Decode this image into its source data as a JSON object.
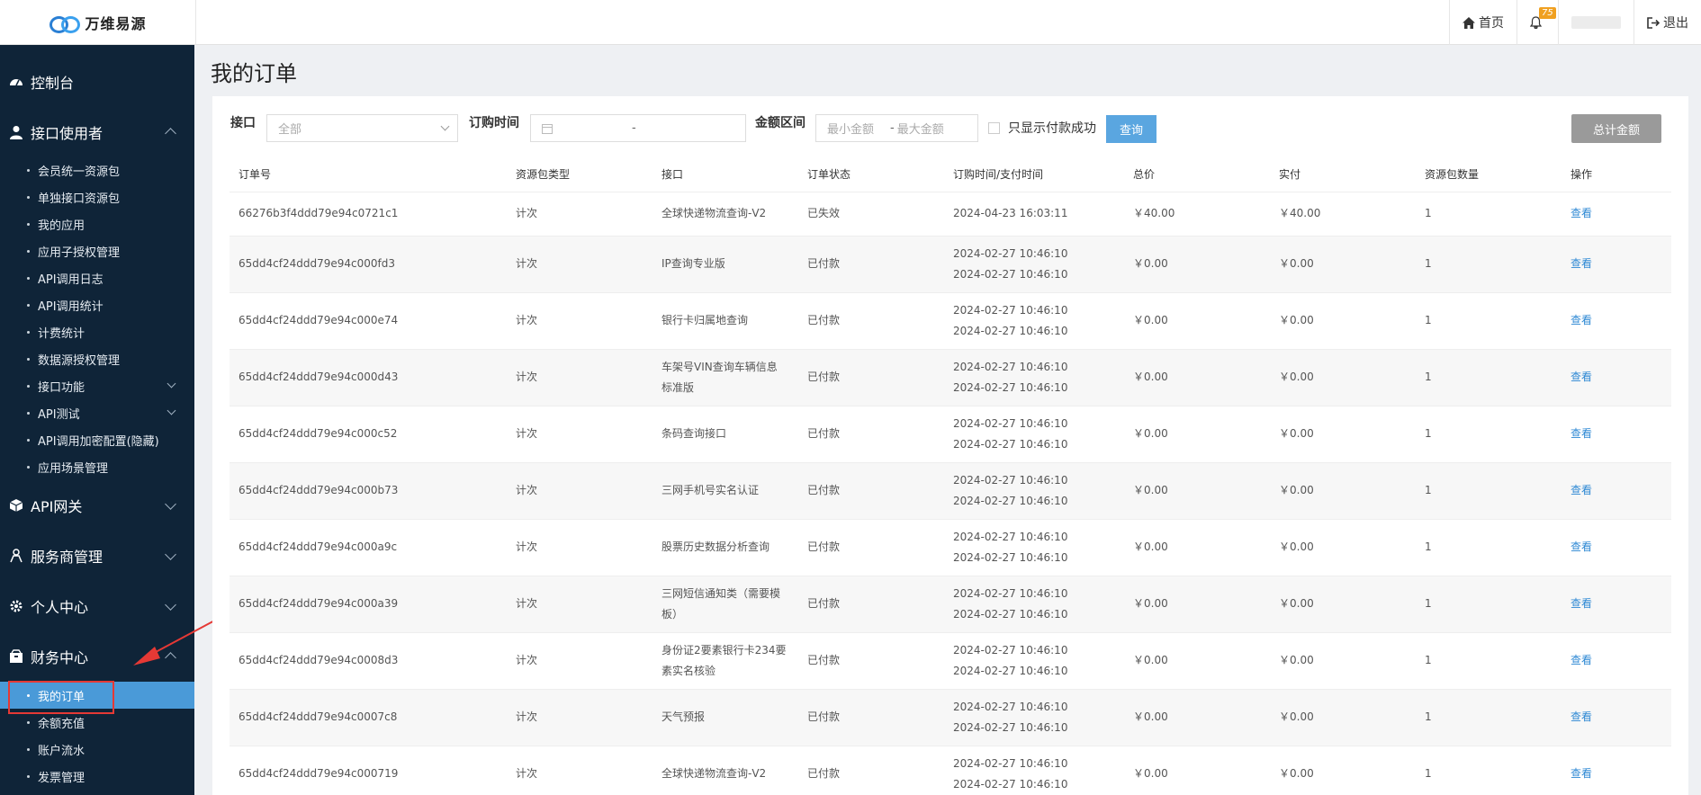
{
  "app": {
    "logo_text": "万维易源"
  },
  "topbar": {
    "home": "首页",
    "notif_count": "75",
    "logout": "退出"
  },
  "sidebar": {
    "console": "控制台",
    "api_user": "接口使用者",
    "api_user_items": [
      "会员统一资源包",
      "单独接口资源包",
      "我的应用",
      "应用子授权管理",
      "API调用日志",
      "API调用统计",
      "计费统计",
      "数据源授权管理",
      "接口功能",
      "API测试",
      "API调用加密配置(隐藏)",
      "应用场景管理"
    ],
    "gateway": "API网关",
    "provider": "服务商管理",
    "personal": "个人中心",
    "finance": "财务中心",
    "finance_items": [
      "我的订单",
      "余额充值",
      "账户流水",
      "发票管理"
    ]
  },
  "page": {
    "title": "我的订单"
  },
  "filters": {
    "api_label": "接口",
    "api_value": "全部",
    "time_label": "订购时间",
    "date_sep": "-",
    "amount_label": "金额区间",
    "min_placeholder": "最小金额",
    "amount_sep": "-",
    "max_placeholder": "最大金额",
    "paid_only": "只显示付款成功",
    "query_btn": "查询",
    "total_btn": "总计金额"
  },
  "table": {
    "headers": [
      "订单号",
      "资源包类型",
      "接口",
      "订单状态",
      "订购时间/支付时间",
      "总价",
      "实付",
      "资源包数量",
      "操作"
    ],
    "rows": [
      {
        "id": "66276b3f4ddd79e94c0721c1",
        "type": "计次",
        "api": "全球快递物流查询-V2",
        "status": "已失效",
        "time1": "2024-04-23 16:03:11",
        "time2": "",
        "total": "￥40.00",
        "paid": "￥40.00",
        "qty": "1",
        "op": "查看"
      },
      {
        "id": "65dd4cf24ddd79e94c000fd3",
        "type": "计次",
        "api": "IP查询专业版",
        "status": "已付款",
        "time1": "2024-02-27 10:46:10",
        "time2": "2024-02-27 10:46:10",
        "total": "￥0.00",
        "paid": "￥0.00",
        "qty": "1",
        "op": "查看"
      },
      {
        "id": "65dd4cf24ddd79e94c000e74",
        "type": "计次",
        "api": "银行卡归属地查询",
        "status": "已付款",
        "time1": "2024-02-27 10:46:10",
        "time2": "2024-02-27 10:46:10",
        "total": "￥0.00",
        "paid": "￥0.00",
        "qty": "1",
        "op": "查看"
      },
      {
        "id": "65dd4cf24ddd79e94c000d43",
        "type": "计次",
        "api": "车架号VIN查询车辆信息标准版",
        "status": "已付款",
        "time1": "2024-02-27 10:46:10",
        "time2": "2024-02-27 10:46:10",
        "total": "￥0.00",
        "paid": "￥0.00",
        "qty": "1",
        "op": "查看"
      },
      {
        "id": "65dd4cf24ddd79e94c000c52",
        "type": "计次",
        "api": "条码查询接口",
        "status": "已付款",
        "time1": "2024-02-27 10:46:10",
        "time2": "2024-02-27 10:46:10",
        "total": "￥0.00",
        "paid": "￥0.00",
        "qty": "1",
        "op": "查看"
      },
      {
        "id": "65dd4cf24ddd79e94c000b73",
        "type": "计次",
        "api": "三网手机号实名认证",
        "status": "已付款",
        "time1": "2024-02-27 10:46:10",
        "time2": "2024-02-27 10:46:10",
        "total": "￥0.00",
        "paid": "￥0.00",
        "qty": "1",
        "op": "查看"
      },
      {
        "id": "65dd4cf24ddd79e94c000a9c",
        "type": "计次",
        "api": "股票历史数据分析查询",
        "status": "已付款",
        "time1": "2024-02-27 10:46:10",
        "time2": "2024-02-27 10:46:10",
        "total": "￥0.00",
        "paid": "￥0.00",
        "qty": "1",
        "op": "查看"
      },
      {
        "id": "65dd4cf24ddd79e94c000a39",
        "type": "计次",
        "api": "三网短信通知类（需要模板）",
        "status": "已付款",
        "time1": "2024-02-27 10:46:10",
        "time2": "2024-02-27 10:46:10",
        "total": "￥0.00",
        "paid": "￥0.00",
        "qty": "1",
        "op": "查看"
      },
      {
        "id": "65dd4cf24ddd79e94c0008d3",
        "type": "计次",
        "api": "身份证2要素银行卡234要素实名核验",
        "status": "已付款",
        "time1": "2024-02-27 10:46:10",
        "time2": "2024-02-27 10:46:10",
        "total": "￥0.00",
        "paid": "￥0.00",
        "qty": "1",
        "op": "查看"
      },
      {
        "id": "65dd4cf24ddd79e94c0007c8",
        "type": "计次",
        "api": "天气预报",
        "status": "已付款",
        "time1": "2024-02-27 10:46:10",
        "time2": "2024-02-27 10:46:10",
        "total": "￥0.00",
        "paid": "￥0.00",
        "qty": "1",
        "op": "查看"
      },
      {
        "id": "65dd4cf24ddd79e94c000719",
        "type": "计次",
        "api": "全球快递物流查询-V2",
        "status": "已付款",
        "time1": "2024-02-27 10:46:10",
        "time2": "2024-02-27 10:46:10",
        "total": "￥0.00",
        "paid": "￥0.00",
        "qty": "1",
        "op": "查看"
      }
    ]
  },
  "colors": {
    "sidebar_bg": "#0f2438",
    "active": "#4a9ad8",
    "link": "#2f89d4",
    "highlight": "#e53935"
  }
}
